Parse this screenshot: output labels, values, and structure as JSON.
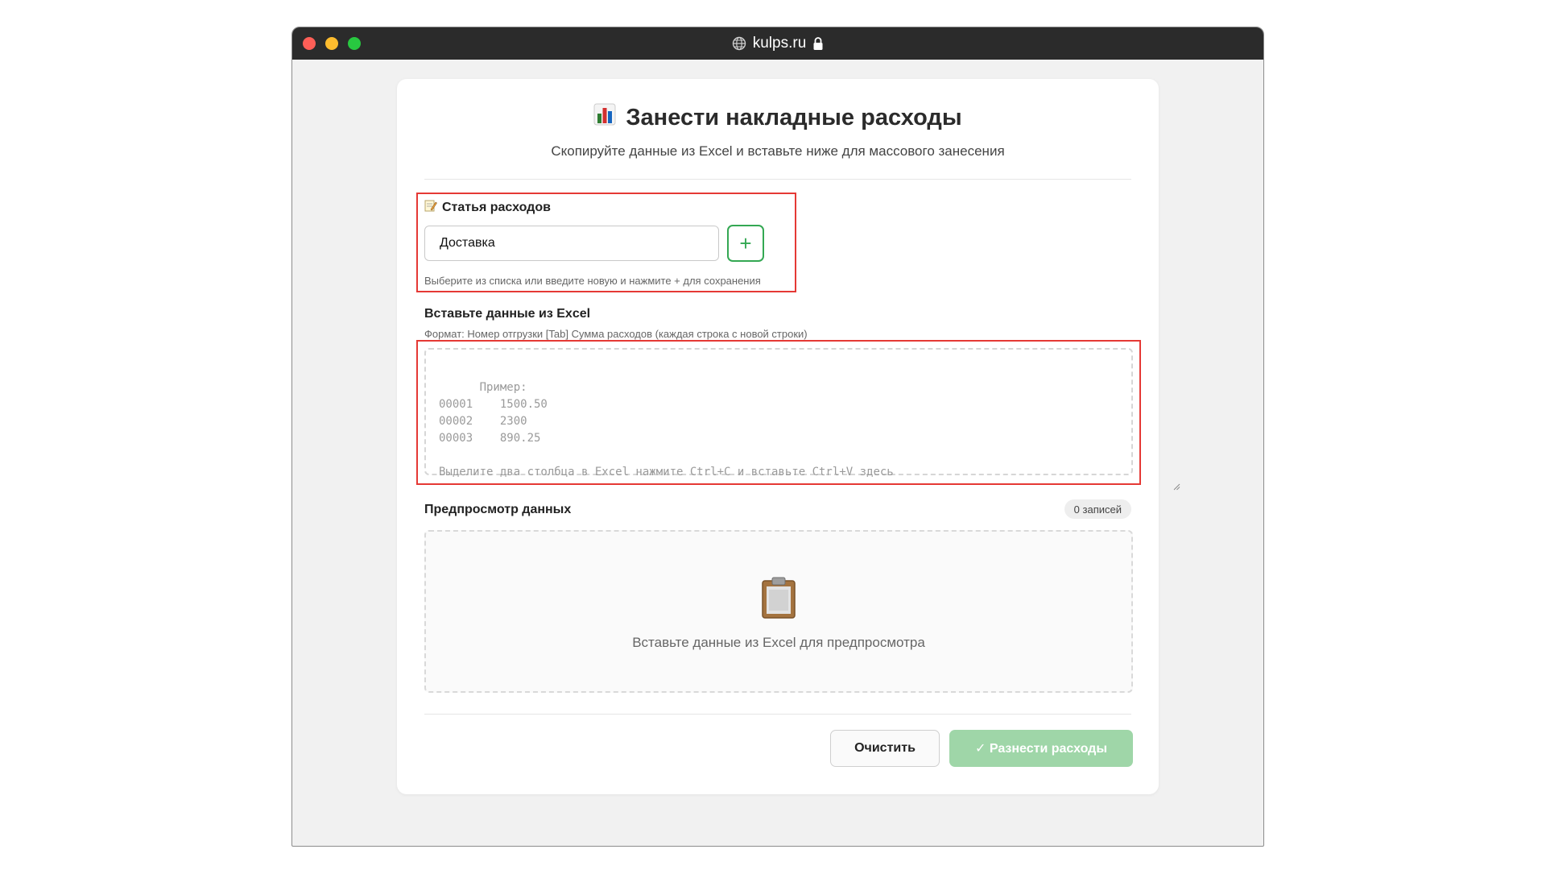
{
  "browser": {
    "url": "kulps.ru"
  },
  "header": {
    "title": "Занести накладные расходы",
    "subtitle": "Скопируйте данные из Excel и вставьте ниже для массового занесения"
  },
  "expense_item": {
    "label": "Статья расходов",
    "value": "Доставка",
    "add_label": "+",
    "hint": "Выберите из списка или введите новую и нажмите + для сохранения"
  },
  "paste": {
    "label": "Вставьте данные из Excel",
    "format_hint": "Формат: Номер отгрузки [Tab] Сумма расходов (каждая строка с новой строки)",
    "placeholder": "Пример:\n00001    1500.50\n00002    2300\n00003    890.25\n\nВыделите два столбца в Excel нажмите Ctrl+C и вставьте Ctrl+V здесь"
  },
  "preview": {
    "label": "Предпросмотр данных",
    "count": "0 записей",
    "empty_text": "Вставьте данные из Excel для предпросмотра"
  },
  "actions": {
    "clear_label": "Очистить",
    "submit_label": "✓ Разнести расходы"
  },
  "colors": {
    "accent": "#34a853",
    "highlight": "#e53935",
    "submit_disabled": "#9fd6a8"
  }
}
